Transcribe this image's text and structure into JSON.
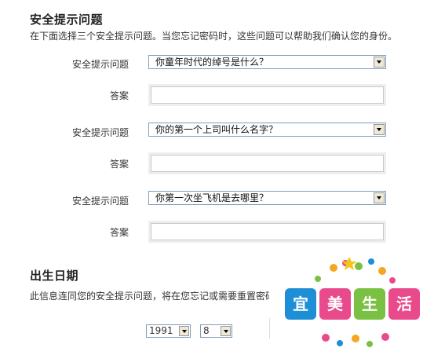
{
  "security": {
    "title": "安全提示问题",
    "description": "在下面选择三个安全提示问题。当您忘记密码时，这些问题可以帮助我们确认您的身份。",
    "question_label": "安全提示问题",
    "answer_label": "答案",
    "questions": [
      {
        "selected": "你童年时代的绰号是什么？",
        "answer": ""
      },
      {
        "selected": "你的第一个上司叫什么名字？",
        "answer": ""
      },
      {
        "selected": "你第一次坐飞机是去哪里？",
        "answer": ""
      }
    ]
  },
  "birthdate": {
    "title": "出生日期",
    "description": "此信息连同您的安全提示问题，将在您忘记或需要重置密码",
    "year": "1991",
    "month": "8"
  },
  "watermark": {
    "chars": [
      "宜",
      "美",
      "生",
      "活"
    ],
    "colors": [
      "#1e8fd6",
      "#e94a8c",
      "#7ac143",
      "#e94a8c"
    ]
  }
}
